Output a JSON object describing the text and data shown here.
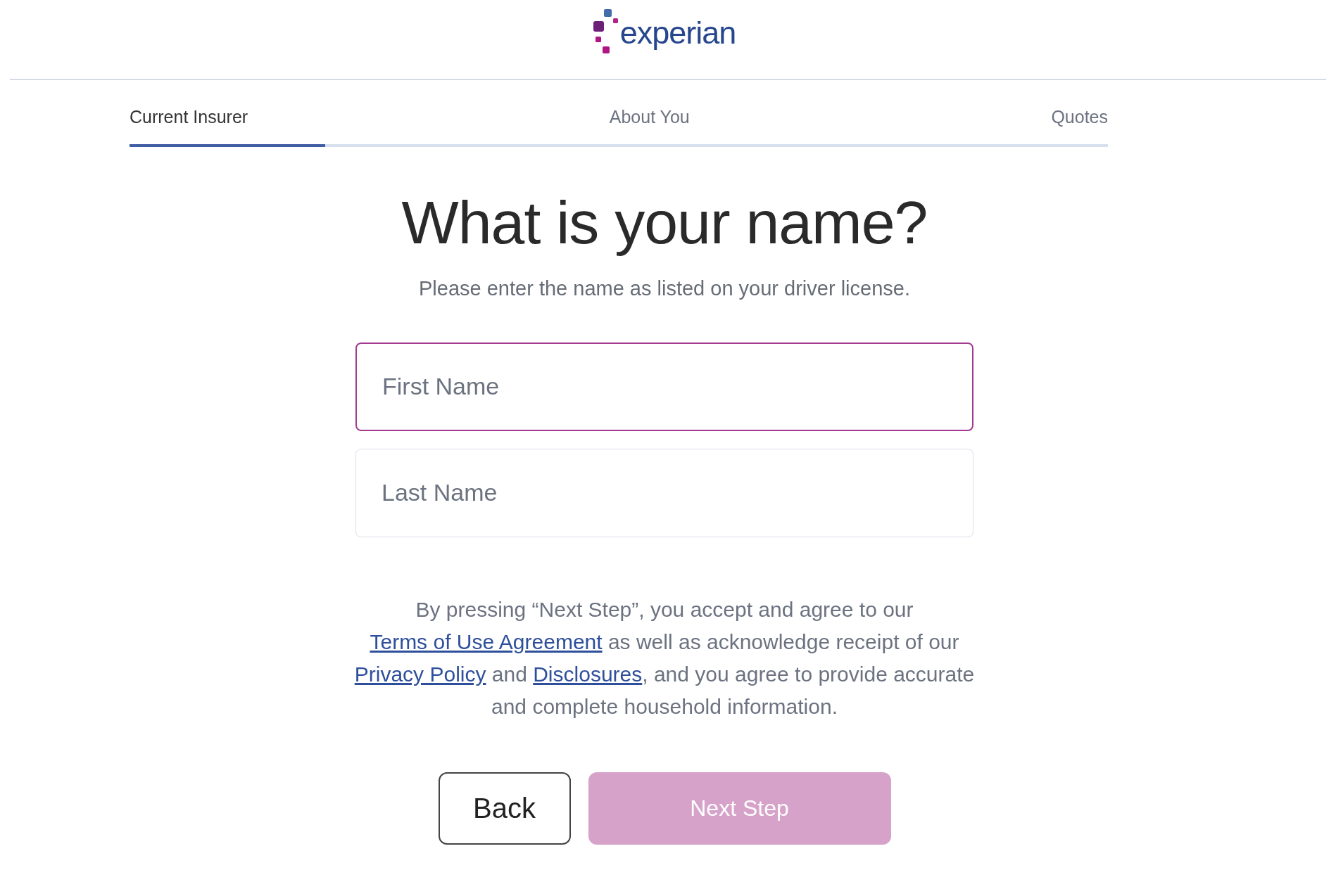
{
  "header": {
    "logo_text": "experian"
  },
  "steps": [
    {
      "label": "Current Insurer",
      "selected": true
    },
    {
      "label": "About You",
      "selected": false
    },
    {
      "label": "Quotes",
      "selected": false
    }
  ],
  "progress": {
    "level": 0.2
  },
  "heading": "What is your name?",
  "subtitle": "Please enter the name as listed on your driver license.",
  "fields": [
    {
      "placeholder": "First Name",
      "focused": true
    },
    {
      "placeholder": "Last Name",
      "focused": false
    }
  ],
  "disclaimer": [
    {
      "kind": "text",
      "text": "By pressing “Next Step”, you accept and agree to our "
    },
    {
      "kind": "link",
      "text": "Terms of Use Agreement"
    },
    {
      "kind": "text",
      "text": " as well as acknowledge receipt of our "
    },
    {
      "kind": "link",
      "text": "Privacy Policy"
    },
    {
      "kind": "text",
      "text": " and "
    },
    {
      "kind": "link",
      "text": "Disclosures"
    },
    {
      "kind": "text",
      "text": ", and you agree to provide accurate and complete household information."
    }
  ],
  "buttons": [
    {
      "label": "Back",
      "kind": "secondary",
      "disabled": false
    },
    {
      "label": "Next Step",
      "kind": "primary",
      "disabled": true
    }
  ]
}
